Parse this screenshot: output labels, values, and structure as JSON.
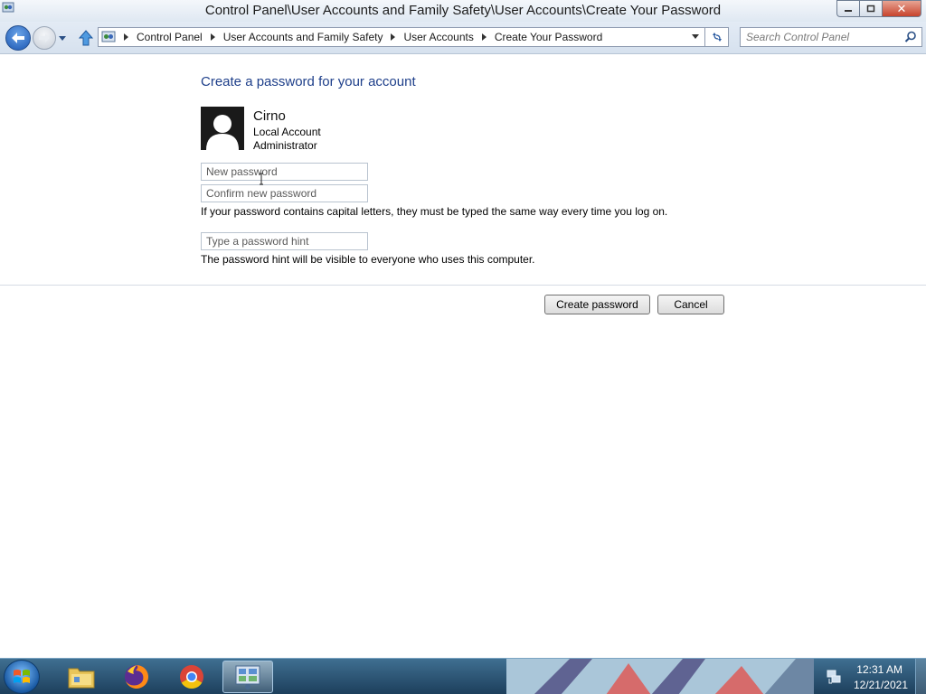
{
  "window": {
    "title": "Control Panel\\User Accounts and Family Safety\\User Accounts\\Create Your Password",
    "minimize_icon": "minimize-icon",
    "maximize_icon": "maximize-icon",
    "close_icon": "close-icon"
  },
  "navigation": {
    "breadcrumbs": [
      "Control Panel",
      "User Accounts and Family Safety",
      "User Accounts",
      "Create Your Password"
    ],
    "search_placeholder": "Search Control Panel"
  },
  "page": {
    "heading": "Create a password for your account",
    "user": {
      "name": "Cirno",
      "account_type": "Local Account",
      "role": "Administrator"
    },
    "fields": {
      "new_password_placeholder": "New password",
      "confirm_password_placeholder": "Confirm new password",
      "hint_placeholder": "Type a password hint"
    },
    "notes": {
      "capitals": "If your password contains capital letters, they must be typed the same way every time you log on.",
      "hint_visibility": "The password hint will be visible to everyone who uses this computer."
    },
    "buttons": {
      "create": "Create password",
      "cancel": "Cancel"
    }
  },
  "taskbar": {
    "pinned": [
      "windows-explorer-icon",
      "firefox-icon",
      "chrome-icon",
      "control-panel-icon"
    ],
    "active_item": "control-panel-icon",
    "clock": {
      "time": "12:31 AM",
      "date": "12/21/2021"
    }
  },
  "colors": {
    "heading_blue": "#1e3f8a",
    "taskbar": "#2b5676",
    "close_button": "#c7432c"
  }
}
